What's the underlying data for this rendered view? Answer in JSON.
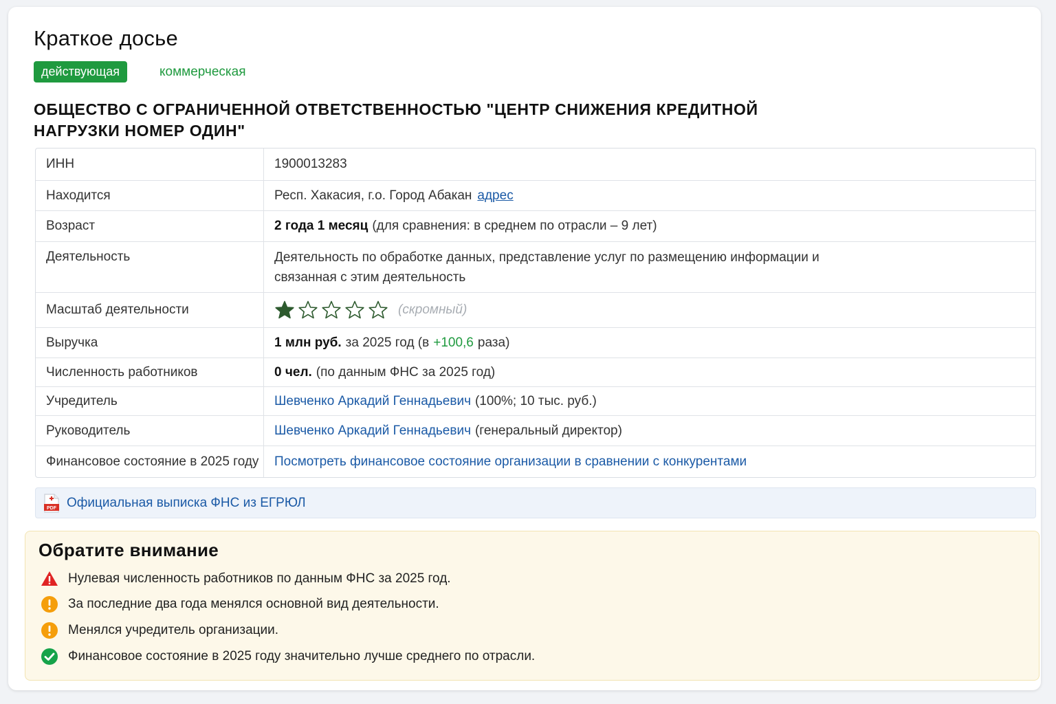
{
  "header": {
    "title": "Краткое досье",
    "status_badge": "действующая",
    "org_type": "коммерческая",
    "org_name": "ОБЩЕСТВО С ОГРАНИЧЕННОЙ ОТВЕТСТВЕННОСТЬЮ \"ЦЕНТР СНИЖЕНИЯ КРЕДИТНОЙ НАГРУЗКИ НОМЕР ОДИН\""
  },
  "table": {
    "inn": {
      "label": "ИНН",
      "value": "1900013283"
    },
    "location": {
      "label": "Находится",
      "value": "Респ. Хакасия, г.о. Город Абакан",
      "link": "адрес"
    },
    "age": {
      "label": "Возраст",
      "value_bold": "2 года 1 месяц",
      "value_rest": "(для сравнения: в среднем по отрасли – 9 лет)"
    },
    "activity": {
      "label": "Деятельность",
      "value": "Деятельность по обработке данных, представление услуг по размещению информации и связанная с этим деятельность"
    },
    "scale": {
      "label": "Масштаб деятельности",
      "rating": 1,
      "max_rating": 5,
      "note": "(скромный)"
    },
    "revenue": {
      "label": "Выручка",
      "value_bold": "1 млн руб.",
      "value_mid": "за 2025 год (в",
      "growth": "+100,6",
      "value_end": "раза)"
    },
    "employees": {
      "label": "Численность работников",
      "value_bold": "0 чел.",
      "value_rest": "(по данным ФНС за 2025 год)"
    },
    "founder": {
      "label": "Учредитель",
      "link": "Шевченко Аркадий Геннадьевич",
      "value_rest": "(100%; 10 тыс. руб.)"
    },
    "director": {
      "label": "Руководитель",
      "link": "Шевченко Аркадий Геннадьевич",
      "value_rest": "(генеральный директор)"
    },
    "finance": {
      "label": "Финансовое состояние в 2025 году",
      "link": "Посмотреть финансовое состояние организации в сравнении с конкурентами"
    }
  },
  "pdf": {
    "icon": "pdf-file-icon",
    "label": "Официальная выписка ФНС из ЕГРЮЛ"
  },
  "attention": {
    "title": "Обратите внимание",
    "items": [
      {
        "icon": "warning-triangle-icon",
        "text": "Нулевая численность работников по данным ФНС за 2025 год."
      },
      {
        "icon": "exclamation-circle-icon",
        "text": "За последние два года менялся основной вид деятельности."
      },
      {
        "icon": "exclamation-circle-icon",
        "text": "Менялся учредитель организации."
      },
      {
        "icon": "check-circle-icon",
        "text": "Финансовое состояние в 2025 году значительно лучше среднего по отрасли."
      }
    ]
  },
  "colors": {
    "status_green": "#1f9a3f",
    "link_blue": "#1b5aa6",
    "star_green": "#2d5a2e",
    "danger_red": "#e02424",
    "warning_orange": "#f59e0b",
    "success_green": "#16a34a"
  }
}
